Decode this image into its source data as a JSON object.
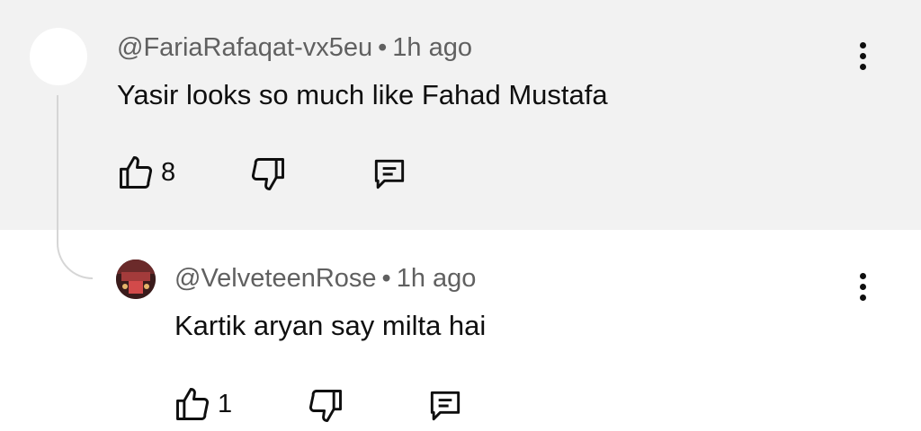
{
  "comments": [
    {
      "author": "@FariaRafaqat-vx5eu",
      "separator": "•",
      "time": "1h ago",
      "text": "Yasir looks so much like Fahad Mustafa",
      "likes": "8",
      "icons": [
        "thumbs-up-icon",
        "thumbs-down-icon",
        "reply-icon",
        "more-vert-icon"
      ]
    },
    {
      "author": "@VelveteenRose",
      "separator": "•",
      "time": "1h ago",
      "text": "Kartik aryan say milta hai",
      "likes": "1",
      "icons": [
        "thumbs-up-icon",
        "thumbs-down-icon",
        "reply-icon",
        "more-vert-icon"
      ]
    }
  ],
  "colors": {
    "highlight_bg": "#f2f2f2",
    "meta_text": "#606060",
    "primary_text": "#0f0f0f"
  }
}
